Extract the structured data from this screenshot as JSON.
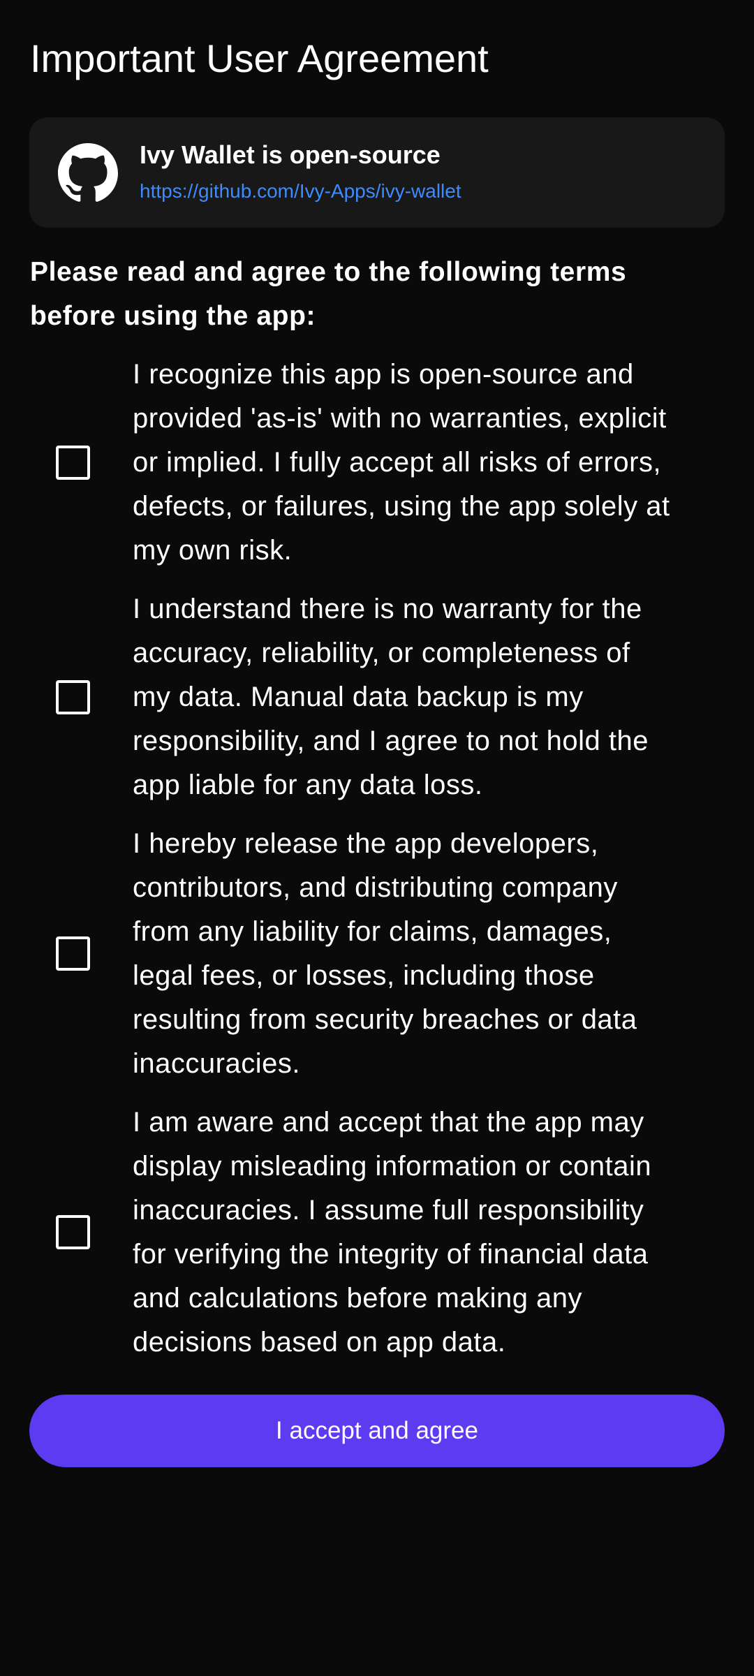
{
  "page": {
    "title": "Important User Agreement"
  },
  "oss_card": {
    "title": "Ivy Wallet is open-source",
    "link": "https://github.com/Ivy-Apps/ivy-wallet",
    "icon": "github-icon"
  },
  "intro": "Please read and agree to the following terms before using the app:",
  "terms": [
    {
      "checked": false,
      "lines": [
        "I recognize this app is open-source and",
        "provided 'as-is' with no warranties, explicit",
        "or implied. I fully accept all risks of errors,",
        "defects, or failures, using the app solely at",
        "my own risk."
      ]
    },
    {
      "checked": false,
      "lines": [
        "I understand there is no warranty for the",
        "accuracy, reliability, or completeness of",
        "my data. Manual data backup is my",
        "responsibility, and I agree to not hold the",
        "app liable for any data loss."
      ]
    },
    {
      "checked": false,
      "lines": [
        "I hereby release the app developers,",
        "contributors, and distributing company",
        "from any liability for claims, damages,",
        "legal fees, or losses, including those",
        "resulting from security breaches or data",
        "inaccuracies."
      ]
    },
    {
      "checked": false,
      "lines": [
        "I am aware and accept that the app may",
        "display misleading information or contain",
        "inaccuracies. I assume full responsibility",
        "for verifying the integrity of financial data",
        "and calculations before making any",
        "decisions based on app data."
      ]
    }
  ],
  "accept_button": {
    "label": "I accept and agree",
    "color": "#5c3bf0"
  },
  "colors": {
    "background": "#0a0a0a",
    "card": "#181818",
    "link": "#3d8bfd"
  }
}
